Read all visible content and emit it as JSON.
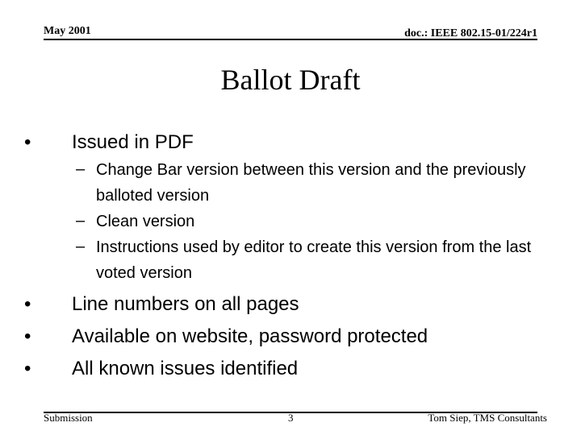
{
  "header": {
    "date": "May 2001",
    "doc_id": "doc.: IEEE 802.15-01/224r1"
  },
  "slide": {
    "title": "Ballot Draft",
    "bullets": [
      {
        "text": "Issued in PDF",
        "sub": [
          "Change Bar version between this version and the previously balloted version",
          "Clean version",
          "Instructions used by editor to create this version from the last voted version"
        ]
      },
      {
        "text": "Line numbers on all pages"
      },
      {
        "text": "Available on website, password protected"
      },
      {
        "text": "All known issues identified"
      }
    ],
    "bullet_glyph": "•",
    "sub_glyph": "–"
  },
  "footer": {
    "left": "Submission",
    "page_number": "3",
    "right": "Tom Siep, TMS Consultants"
  }
}
